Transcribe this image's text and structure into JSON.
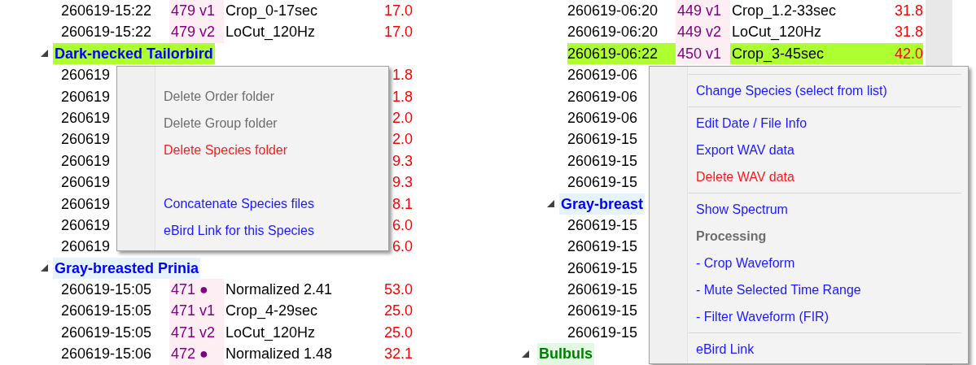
{
  "left_panel": {
    "nodes": [
      {
        "kind": "row",
        "date": "260619-15:22",
        "id": "479 v1",
        "name": "Crop_0-17sec",
        "value": "17.0",
        "selected": false
      },
      {
        "kind": "row",
        "date": "260619-15:22",
        "id": "479 v2",
        "name": "LoCut_120Hz",
        "value": "17.0",
        "selected": false
      },
      {
        "kind": "species",
        "label": "Dark-necked Tailorbird",
        "selected": true,
        "children": [
          {
            "kind": "row",
            "date": "260619",
            "value": "1.8",
            "selected": false
          },
          {
            "kind": "row",
            "date": "260619",
            "value": "1.8",
            "selected": false
          },
          {
            "kind": "row",
            "date": "260619",
            "value": "2.0",
            "selected": false
          },
          {
            "kind": "row",
            "date": "260619",
            "value": "2.0",
            "selected": false
          },
          {
            "kind": "row",
            "date": "260619",
            "value": "9.3",
            "selected": false
          },
          {
            "kind": "row",
            "date": "260619",
            "value": "9.3",
            "selected": false
          },
          {
            "kind": "row",
            "date": "260619",
            "value": "8.1",
            "selected": false
          },
          {
            "kind": "row",
            "date": "260619",
            "value": "6.0",
            "selected": false
          },
          {
            "kind": "row",
            "date": "260619",
            "value": "6.0",
            "selected": false
          }
        ]
      },
      {
        "kind": "species",
        "label": "Gray-breasted Prinia",
        "selected": false,
        "children": [
          {
            "kind": "row",
            "date": "260619-15:05",
            "id": "471 ●",
            "name": "Normalized 2.41",
            "value": "53.0",
            "selected": false
          },
          {
            "kind": "row",
            "date": "260619-15:05",
            "id": "471 v1",
            "name": "Crop_4-29sec",
            "value": "25.0",
            "selected": false
          },
          {
            "kind": "row",
            "date": "260619-15:05",
            "id": "471 v2",
            "name": "LoCut_120Hz",
            "value": "25.0",
            "selected": false
          },
          {
            "kind": "row",
            "date": "260619-15:06",
            "id": "472 ●",
            "name": "Normalized 1.48",
            "value": "32.1",
            "selected": false
          }
        ]
      }
    ]
  },
  "left_menu": {
    "items": [
      {
        "kind": "action",
        "label": "Delete Order folder",
        "disabled": true
      },
      {
        "kind": "action",
        "label": "Delete Group folder",
        "disabled": true
      },
      {
        "kind": "danger",
        "label": "Delete Species folder",
        "disabled": false
      },
      {
        "kind": "spacer"
      },
      {
        "kind": "action",
        "label": "Concatenate Species files",
        "disabled": false
      },
      {
        "kind": "action",
        "label": "eBird Link for this Species",
        "disabled": false
      }
    ]
  },
  "right_panel": {
    "nodes": [
      {
        "kind": "row",
        "date": "260619-06:20",
        "id": "449 v1",
        "name": "Crop_1.2-33sec",
        "value": "31.8",
        "selected": false
      },
      {
        "kind": "row",
        "date": "260619-06:20",
        "id": "449 v2",
        "name": "LoCut_120Hz",
        "value": "31.8",
        "selected": false
      },
      {
        "kind": "row",
        "date": "260619-06:22",
        "id": "450 v1",
        "name": "Crop_3-45sec",
        "value": "42.0",
        "selected": true
      },
      {
        "kind": "row",
        "date": "260619-06",
        "selected": false
      },
      {
        "kind": "row",
        "date": "260619-06",
        "selected": false
      },
      {
        "kind": "row",
        "date": "260619-06",
        "selected": false
      },
      {
        "kind": "row",
        "date": "260619-15",
        "selected": false
      },
      {
        "kind": "row",
        "date": "260619-15",
        "selected": false
      },
      {
        "kind": "row",
        "date": "260619-15",
        "selected": false
      },
      {
        "kind": "species",
        "label": "Gray-breast",
        "selected": false,
        "children": [
          {
            "kind": "row",
            "date": "260619-15",
            "selected": false
          },
          {
            "kind": "row",
            "date": "260619-15",
            "selected": false
          },
          {
            "kind": "row",
            "date": "260619-15",
            "selected": false
          },
          {
            "kind": "row",
            "date": "260619-15",
            "selected": false
          },
          {
            "kind": "row",
            "date": "260619-15",
            "selected": false
          },
          {
            "kind": "row",
            "date": "260619-15",
            "selected": false
          }
        ]
      },
      {
        "kind": "group",
        "label": "Bulbuls",
        "selected": false
      }
    ]
  },
  "right_menu": {
    "items": [
      {
        "kind": "separator"
      },
      {
        "kind": "action",
        "label": "Change Species (select from list)",
        "disabled": false
      },
      {
        "kind": "separator"
      },
      {
        "kind": "action",
        "label": "Edit Date / File Info",
        "disabled": false
      },
      {
        "kind": "action",
        "label": "Export WAV data",
        "disabled": false
      },
      {
        "kind": "danger",
        "label": "Delete WAV data",
        "disabled": false
      },
      {
        "kind": "separator"
      },
      {
        "kind": "action",
        "label": "Show Spectrum",
        "disabled": false
      },
      {
        "kind": "heading",
        "label": "Processing"
      },
      {
        "kind": "action",
        "label": "- Crop Waveform",
        "disabled": false
      },
      {
        "kind": "action",
        "label": "- Mute Selected Time Range",
        "disabled": false
      },
      {
        "kind": "action",
        "label": "- Filter Waveform (FIR)",
        "disabled": false
      },
      {
        "kind": "separator"
      },
      {
        "kind": "action",
        "label": "eBird Link",
        "disabled": false
      }
    ]
  }
}
